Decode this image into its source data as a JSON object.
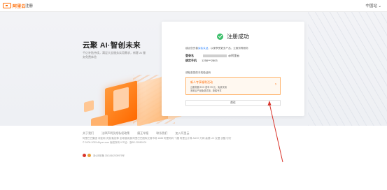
{
  "topbar": {
    "logo_text": "阿里云",
    "register": "注册",
    "language": "中国站"
  },
  "hero": {
    "title": "云聚 AI·智创未来",
    "sub1": "千亿补贴持续，满足大云服务实用需求，新客 AI 服",
    "sub2": "务免费体验"
  },
  "card": {
    "success_title": "注册成功",
    "note_prefix": "建议您完善",
    "note_link": "实名认证",
    "note_suffix": "，以便享受更多产品、云服务等服务",
    "account_label": "登录名",
    "account_suffix": "@阿里云",
    "phone_label": "绑定手机",
    "phone_value": "1258***2803",
    "hint": "请检查您的手机验证码",
    "promo_title": "新人专享福利活动",
    "promo_line1": "云服务器 ECS 首年 99 元，免费试用",
    "promo_line2": "多款云产品免费试用，新客专享",
    "button": "前往"
  },
  "footer": {
    "links": [
      "关于我们",
      "法律声明及隐私权政策",
      "廉正举报",
      "联系我们",
      "加入阿里云"
    ],
    "row2": "阿里巴巴集团 淘宝网 天猫 聚划算 全球速卖通 阿里巴巴国际交易市场 1688 阿里妈妈 飞猪 阿里云计算 AliOS 万网 高德 UC 友盟 优酷 钉钉",
    "row3": "© 2009-2025 Aliyun.com 版权所有 ICP证：浙B2-20080101",
    "row4": "",
    "beian": "浙公网安备 33010602009975号"
  },
  "colors": {
    "accent": "#ff6a00",
    "success": "#3bbf6a",
    "link": "#1677ff"
  }
}
